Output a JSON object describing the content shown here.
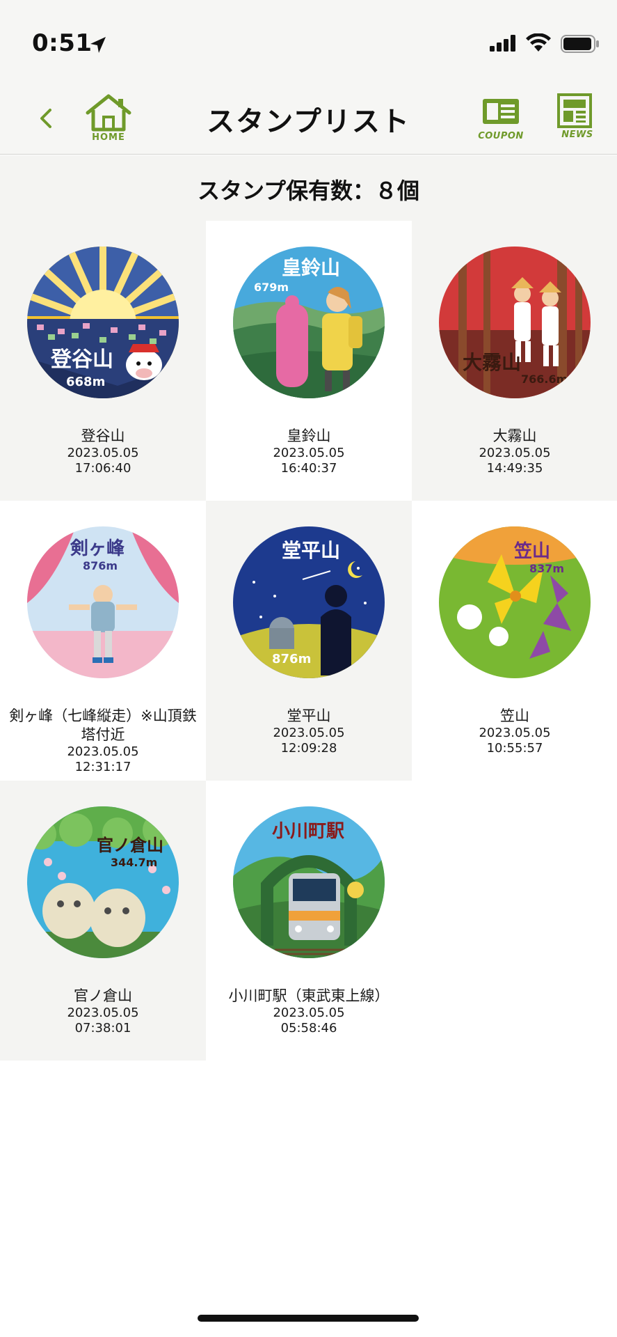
{
  "status_bar": {
    "time": "0:51"
  },
  "nav": {
    "title": "スタンプリスト",
    "home_label": "HOME",
    "coupon_label": "COUPON",
    "news_label": "NEWS"
  },
  "summary": {
    "text": "スタンプ保有数：８個"
  },
  "colors": {
    "accent": "#6f9a2a",
    "background_shade": "#f4f4f2"
  },
  "stamps": [
    {
      "name": "登谷山",
      "date": "2023.05.05",
      "time": "17:06:40",
      "artwork_text": "登谷山",
      "artwork_elevation": "668m"
    },
    {
      "name": "皇鈴山",
      "date": "2023.05.05",
      "time": "16:40:37",
      "artwork_text": "皇鈴山",
      "artwork_elevation": "679m"
    },
    {
      "name": "大霧山",
      "date": "2023.05.05",
      "time": "14:49:35",
      "artwork_text": "大霧山",
      "artwork_elevation": "766.6m"
    },
    {
      "name": "剣ヶ峰（七峰縦走）※山頂鉄塔付近",
      "date": "2023.05.05",
      "time": "12:31:17",
      "artwork_text": "剣ヶ峰",
      "artwork_elevation": "876m"
    },
    {
      "name": "堂平山",
      "date": "2023.05.05",
      "time": "12:09:28",
      "artwork_text": "堂平山",
      "artwork_elevation": "876m"
    },
    {
      "name": "笠山",
      "date": "2023.05.05",
      "time": "10:55:57",
      "artwork_text": "笠山",
      "artwork_elevation": "837m"
    },
    {
      "name": "官ノ倉山",
      "date": "2023.05.05",
      "time": "07:38:01",
      "artwork_text": "官ノ倉山",
      "artwork_elevation": "344.7m"
    },
    {
      "name": "小川町駅（東武東上線）",
      "date": "2023.05.05",
      "time": "05:58:46",
      "artwork_text": "小川町駅",
      "artwork_elevation": ""
    }
  ]
}
